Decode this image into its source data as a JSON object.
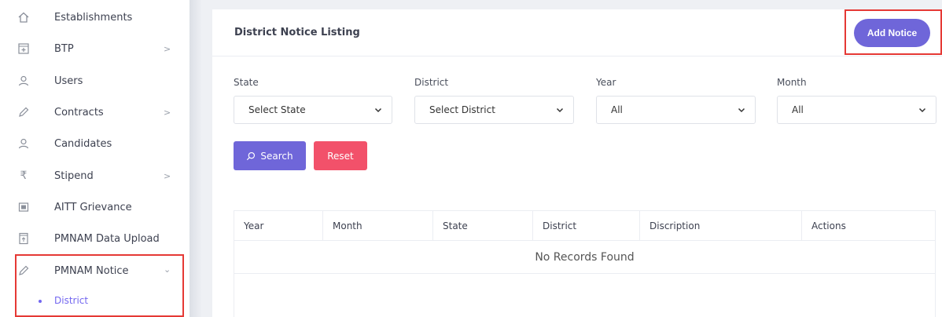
{
  "sidebar": {
    "items": [
      {
        "label": "Establishments",
        "icon": "home-icon",
        "chevron": false
      },
      {
        "label": "BTP",
        "icon": "plus-square-icon",
        "chevron": true
      },
      {
        "label": "Users",
        "icon": "users-icon",
        "chevron": false
      },
      {
        "label": "Contracts",
        "icon": "pencil-icon",
        "chevron": true
      },
      {
        "label": "Candidates",
        "icon": "users-icon",
        "chevron": false
      },
      {
        "label": "Stipend",
        "icon": "rupee-icon",
        "chevron": true
      },
      {
        "label": "AITT Grievance",
        "icon": "grievance-icon",
        "chevron": false
      },
      {
        "label": "PMNAM Data Upload",
        "icon": "upload-file-icon",
        "chevron": false
      },
      {
        "label": "PMNAM Notice",
        "icon": "pencil-icon",
        "chevron": "down"
      }
    ],
    "chevron_right": ">",
    "chevron_down": "⌄",
    "sub_item": {
      "label": "District"
    },
    "accent": "#7367f0"
  },
  "header": {
    "title": "District Notice Listing",
    "add_label": "Add Notice"
  },
  "filters": {
    "state": {
      "label": "State",
      "value": "Select State"
    },
    "district": {
      "label": "District",
      "value": "Select District"
    },
    "year": {
      "label": "Year",
      "value": "All"
    },
    "month": {
      "label": "Month",
      "value": "All"
    }
  },
  "buttons": {
    "search": "Search",
    "reset": "Reset",
    "search_color": "#6f66d9",
    "reset_color": "#f2516a"
  },
  "table": {
    "columns": [
      "Year",
      "Month",
      "State",
      "District",
      "Discription",
      "Actions"
    ],
    "empty_text": "No Records Found"
  }
}
